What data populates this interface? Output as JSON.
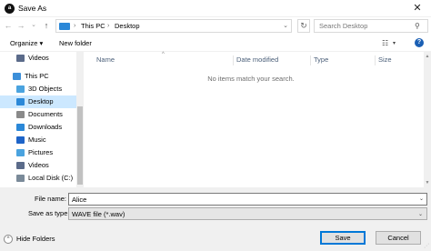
{
  "window": {
    "title": "Save As",
    "app_icon_letter": "a",
    "close_glyph": "✕"
  },
  "nav": {
    "back_glyph": "←",
    "forward_glyph": "→",
    "recent_glyph": "⌄",
    "up_glyph": "↑",
    "breadcrumbs": [
      "This PC",
      "Desktop"
    ],
    "chevron_glyph": "›",
    "address_dropdown_glyph": "⌄",
    "refresh_glyph": "↻",
    "search_placeholder": "Search Desktop",
    "search_glyph": "⚲"
  },
  "toolbar": {
    "organize_label": "Organize ▾",
    "new_folder_label": "New folder",
    "view_glyph": "☷",
    "view_dropdown_glyph": "▾",
    "help_glyph": "?"
  },
  "sidebar": {
    "items": [
      {
        "label": "Videos",
        "icon": "videos-icon",
        "color": "#5b6b8a"
      },
      {
        "label": "This PC",
        "icon": "this-pc-icon",
        "color": "#3c8fd9"
      },
      {
        "label": "3D Objects",
        "icon": "3d-objects-icon",
        "color": "#4aa3df"
      },
      {
        "label": "Desktop",
        "icon": "desktop-icon",
        "color": "#2b88d8"
      },
      {
        "label": "Documents",
        "icon": "documents-icon",
        "color": "#8a8a8a"
      },
      {
        "label": "Downloads",
        "icon": "downloads-icon",
        "color": "#2b88d8"
      },
      {
        "label": "Music",
        "icon": "music-icon",
        "color": "#1e64c8"
      },
      {
        "label": "Pictures",
        "icon": "pictures-icon",
        "color": "#4aa3df"
      },
      {
        "label": "Videos",
        "icon": "videos-icon",
        "color": "#5b6b8a"
      },
      {
        "label": "Local Disk (C:)",
        "icon": "local-disk-icon",
        "color": "#7a8a99"
      }
    ],
    "selected": "Desktop"
  },
  "file_list": {
    "columns": [
      "Name",
      "Date modified",
      "Type",
      "Size"
    ],
    "sort_glyph": "^",
    "empty_message": "No items match your search.",
    "scroll_up_glyph": "▲",
    "scroll_down_glyph": "▼"
  },
  "form": {
    "file_name_label": "File name:",
    "file_name_value": "Alice",
    "dropdown_glyph": "⌄",
    "save_as_type_label": "Save as type:",
    "save_as_type_value": "WAVE file (*.wav)",
    "hide_folders_glyph": "^",
    "hide_folders_label": "Hide Folders",
    "save_label": "Save",
    "cancel_label": "Cancel",
    "grip_glyph": "⋰"
  },
  "colors": {
    "selection": "#cce8ff",
    "accent": "#0078d7",
    "footer": "#f0f0f0"
  }
}
